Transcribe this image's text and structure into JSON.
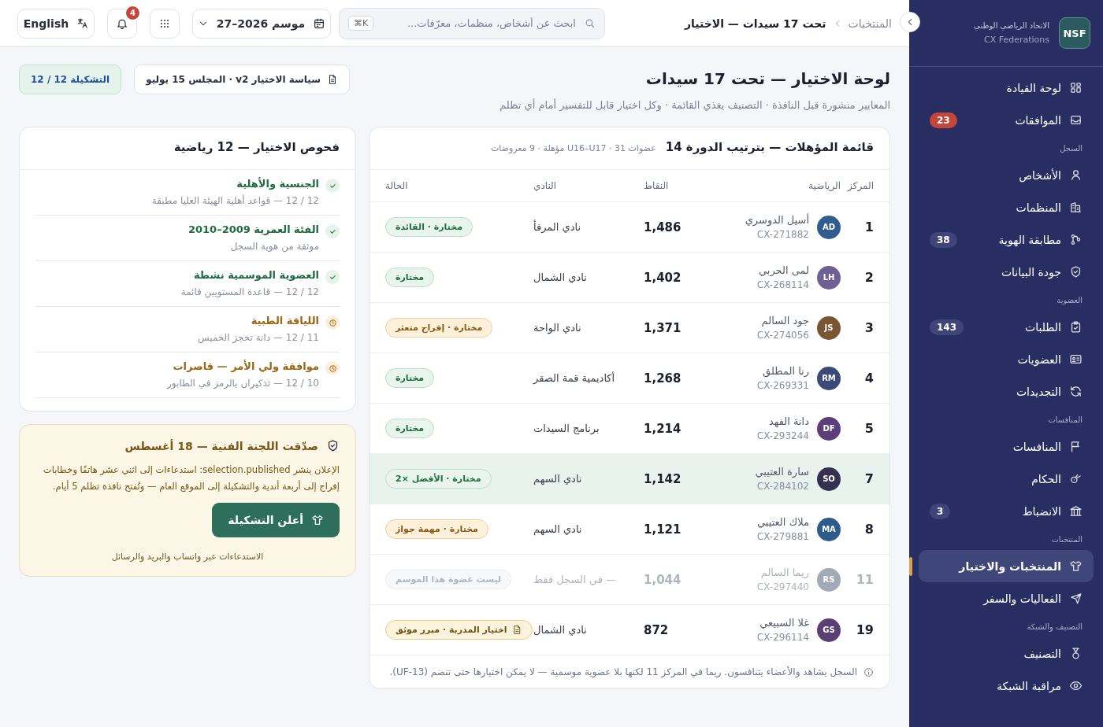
{
  "sidebar": {
    "logo": "NSF",
    "org_name": "الاتحاد الرياضي الوطني",
    "org_sub": "CX Federations",
    "sections": [
      {
        "items": [
          {
            "label": "لوحة القيادة",
            "selected": false
          },
          {
            "label": "الموافقات",
            "badge": "23",
            "urgent": true,
            "selected": false
          }
        ]
      },
      {
        "label": "السجل",
        "items": [
          {
            "label": "الأشخاص",
            "selected": false
          },
          {
            "label": "المنظمات",
            "selected": false
          },
          {
            "label": "مطابقة الهوية",
            "badge": "38",
            "urgent": false,
            "selected": false
          },
          {
            "label": "جودة البيانات",
            "selected": false
          }
        ]
      },
      {
        "label": "العضوية",
        "items": [
          {
            "label": "الطلبات",
            "badge": "143",
            "urgent": false,
            "selected": false
          },
          {
            "label": "العضويات",
            "selected": false
          },
          {
            "label": "التجديدات",
            "selected": false
          }
        ]
      },
      {
        "label": "المنافسات",
        "items": [
          {
            "label": "المنافسات",
            "selected": false
          },
          {
            "label": "الحكام",
            "selected": false
          },
          {
            "label": "الانضباط",
            "badge": "3",
            "urgent": false,
            "selected": false
          }
        ]
      },
      {
        "label": "المنتخبات",
        "items": [
          {
            "label": "المنتخبات والاختيار",
            "selected": true
          },
          {
            "label": "الفعاليات والسفر",
            "selected": false
          }
        ]
      },
      {
        "label": "التصنيف والشبكة",
        "items": [
          {
            "label": "التصنيف",
            "selected": false
          },
          {
            "label": "مراقبة الشبكة",
            "selected": false
          }
        ]
      }
    ]
  },
  "top_bar": {
    "breadcrumb": [
      "المنتخبات",
      "تحت 17 سيدات — الاختيار"
    ],
    "search": {
      "placeholder": "ابحث عن أشخاص، منظمات، معرّفات...",
      "shortcut": "⌘K"
    },
    "season": "موسم 2026–27",
    "notifications": "4",
    "language": "English"
  },
  "header": {
    "title": "لوحة الاختيار — تحت 17 سيدات",
    "subtitle": "المعايير منشورة قبل النافذة · التصنيف يغذي القائمة · وكل اختيار قابل للتفسير أمام أي تظلم",
    "policy": "سياسة الاختيار v2 · المجلس 15 يوليو",
    "lineup": "التشكيلة 12 / 12"
  },
  "table": {
    "title": "قائمة المؤهلات — بترتيب الدورة 14",
    "meta": "عضوات U16–U17 · 31 مؤهلة · 9 معروضات",
    "columns": [
      "المركز",
      "الرياضية",
      "النقاط",
      "النادي",
      "الحالة"
    ],
    "rows": [
      {
        "rank": "1",
        "initials": "AD",
        "color": "#2f5d8f",
        "name": "أسيل الدوسري",
        "id": "CX-271882",
        "points": "1,486",
        "club": "نادي المرفأ",
        "status": "مختارة · القائدة",
        "kind": "selected",
        "selected": false,
        "muted": false
      },
      {
        "rank": "2",
        "initials": "LH",
        "color": "#6e5f95",
        "name": "لمى الحربي",
        "id": "CX-268114",
        "points": "1,402",
        "club": "نادي الشمال",
        "status": "مختارة",
        "kind": "selected",
        "selected": false,
        "muted": false
      },
      {
        "rank": "3",
        "initials": "JS",
        "color": "#7a5532",
        "name": "جود السالم",
        "id": "CX-274056",
        "points": "1,371",
        "club": "نادي الواحة",
        "status": "مختارة · إفراج متعثر",
        "kind": "flagged",
        "selected": false,
        "muted": false
      },
      {
        "rank": "4",
        "initials": "RM",
        "color": "#3b4a78",
        "name": "رنا المطلق",
        "id": "CX-269331",
        "points": "1,268",
        "club": "أكاديمية قمة الصقر",
        "status": "مختارة",
        "kind": "selected",
        "selected": false,
        "muted": false
      },
      {
        "rank": "5",
        "initials": "DF",
        "color": "#5c3f78",
        "name": "دانة الفهد",
        "id": "CX-293244",
        "points": "1,214",
        "club": "برنامج السيدات",
        "status": "مختارة",
        "kind": "selected",
        "selected": false,
        "muted": false
      },
      {
        "rank": "7",
        "initials": "SO",
        "color": "#35304f",
        "name": "سارة العتيبي",
        "id": "CX-284102",
        "points": "1,142",
        "club": "نادي السهم",
        "status": "مختارة · الأفضل ×2",
        "kind": "selected",
        "selected": true,
        "muted": false
      },
      {
        "rank": "8",
        "initials": "MA",
        "color": "#2c5b8c",
        "name": "ملاك العتيبي",
        "id": "CX-279881",
        "points": "1,121",
        "club": "نادي السهم",
        "status": "مختارة · مهمة جواز",
        "kind": "flagged",
        "selected": false,
        "muted": false
      },
      {
        "rank": "11",
        "initials": "RS",
        "color": "#a4a9b8",
        "name": "ريما السالم",
        "id": "CX-297440",
        "points": "1,044",
        "club": "— في السجل فقط",
        "status": "ليست عضوة هذا الموسم",
        "kind": "inactive",
        "selected": false,
        "muted": true
      },
      {
        "rank": "19",
        "initials": "GS",
        "color": "#5a3f72",
        "name": "غلا السبيعي",
        "id": "CX-296114",
        "points": "872",
        "club": "نادي الشمال",
        "status": "اختيار المدربة · مبرر موثق",
        "kind": "document",
        "selected": false,
        "muted": false
      }
    ],
    "footnote": "السجل يشاهد والأعضاء يتنافسون. ريما في المركز 11 لكنها بلا عضوية موسمية — لا يمكن اختيارها حتى تنضم (UF-13)."
  },
  "checks": {
    "title": "فحوص الاختيار — 12 رياضية",
    "items": [
      {
        "title": "الجنسية والأهلية",
        "detail": "12 / 12 — قواعد أهلية الهيئة العليا مطبقة",
        "passed": true
      },
      {
        "title": "الفئة العمرية 2009–2010",
        "detail": "موثقة من هوية السجل",
        "passed": true
      },
      {
        "title": "العضوية الموسمية نشطة",
        "detail": "12 / 12 — قاعدة المستويين قائمة",
        "passed": true
      },
      {
        "title": "اللياقة الطبية",
        "detail": "11 / 12 — دانة تحجز الخميس",
        "passed": false
      },
      {
        "title": "موافقة ولي الأمر — قاصرات",
        "detail": "10 / 12 — تذكيران بالرمز في الطابور",
        "passed": false
      }
    ]
  },
  "publish": {
    "title": "صدّقت اللجنة الفنية — 18 أغسطس",
    "body": "الإعلان ينشر selection.published: استدعاءات إلى اثني عشر هاتفًا وخطابات إفراج إلى أربعة أندية والتشكيلة إلى الموقع العام — وتُفتح نافذة تظلم 5 أيام.",
    "button": "أعلن التشكيلة",
    "note": "الاستدعاءات عبر واتساب والبريد والرسائل"
  }
}
